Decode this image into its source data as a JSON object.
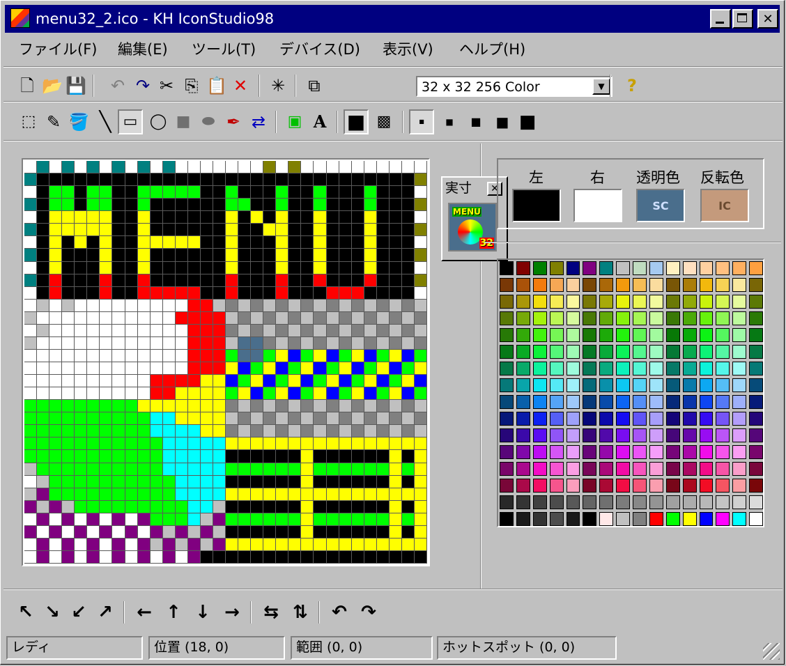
{
  "window": {
    "title": "menu32_2.ico - KH IconStudio98"
  },
  "menu": [
    {
      "label": "ファイル(F)"
    },
    {
      "label": "編集(E)"
    },
    {
      "label": "ツール(T)"
    },
    {
      "label": "デバイス(D)"
    },
    {
      "label": "表示(V)"
    },
    {
      "label": "ヘルプ(H)"
    }
  ],
  "toolbar": {
    "format_combo": "32 x 32  256 Color"
  },
  "preview": {
    "title": "実寸"
  },
  "colors": {
    "left_label": "左",
    "right_label": "右",
    "transparent_label": "透明色",
    "invert_label": "反転色",
    "left_color": "#000000",
    "right_color": "#ffffff",
    "transparent_text": "SC",
    "invert_text": "IC",
    "transparent_color": "#4a6e8c",
    "invert_color": "#c49a7c"
  },
  "status": {
    "ready": "レディ",
    "position": "位置 (18, 0)",
    "range": "範囲 (0, 0)",
    "hotspot": "ホットスポット (0, 0)"
  }
}
